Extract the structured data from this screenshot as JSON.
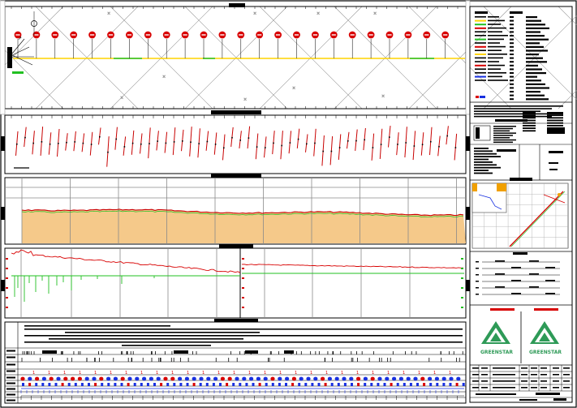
{
  "drawing": {
    "logo_text_left": "GREENSTAR",
    "logo_text_right": "GREENSTAR"
  },
  "colors": {
    "frame": "#000000",
    "route_line": "#ffd400",
    "marker_red": "#d80000",
    "depth_line": "#c80000",
    "current_green": "#22c022",
    "soil_fill": "#f5c98a",
    "grid_gray": "#8a8a8a",
    "blue_marker": "#1830e0",
    "logo_green": "#2e9a57",
    "map_orange": "#f0a000"
  },
  "icons": {
    "north_arrow": "north-arrow-icon",
    "compass": "compass-icon"
  }
}
